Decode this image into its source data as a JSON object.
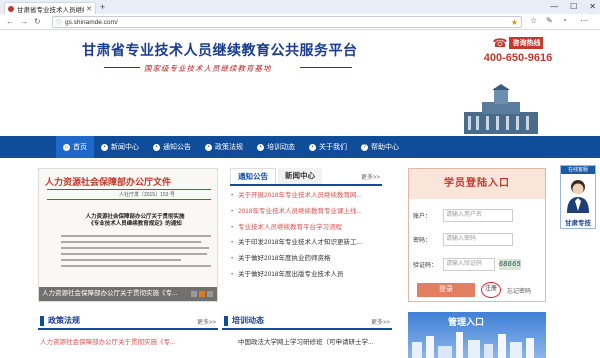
{
  "browser": {
    "tab_title": "甘肃省专业技术人员继续...",
    "url": "gs.shinamde.com/",
    "newtab": "+",
    "win_min": "—",
    "win_max": "☐",
    "win_close": "✕",
    "back": "←",
    "forward": "→",
    "refresh": "↻",
    "star": "★",
    "menu": "⋯"
  },
  "header": {
    "title": "甘肃省专业技术人员继续教育公共服务平台",
    "subtitle": "国家级专业技术人员继续教育基地",
    "hotline_label": "咨询热线",
    "hotline_number": "400-650-9616"
  },
  "nav": {
    "items": [
      {
        "label": "首页"
      },
      {
        "label": "新闻中心"
      },
      {
        "label": "通知公告"
      },
      {
        "label": "政策法规"
      },
      {
        "label": "培训动态"
      },
      {
        "label": "关于我们"
      },
      {
        "label": "帮助中心"
      }
    ]
  },
  "slide": {
    "doc_title": "人力资源社会保障部办公厅文件",
    "doc_number": "人社厅发〔2015〕153 号",
    "doc_heading": "人力资源社会保障部办公厅关于贯彻实施《专业技术人员继续教育规定》的通知",
    "caption": "人力资源社会保障部办公厅关于贯彻实施《专..."
  },
  "notice": {
    "tabs": [
      "通知公告",
      "新闻中心"
    ],
    "more": "更多>>",
    "items": [
      {
        "text": "关于开展2018年专业技术人员继续教育网...",
        "red": true
      },
      {
        "text": "2018年专业技术人员继续教育专业课上线...",
        "red": true
      },
      {
        "text": "专业技术人员继续教育平台学习流程",
        "red": true
      },
      {
        "text": "关于印发2018年专业技术人才知识更新工...",
        "red": false
      },
      {
        "text": "关于做好2018年度执业药师资格",
        "red": false
      },
      {
        "text": "关于做好2018年度出版专业技术人员",
        "red": false
      }
    ]
  },
  "login": {
    "title": "学员登陆入口",
    "account_label": "账户：",
    "account_placeholder": "请输入用户名",
    "password_label": "密码：",
    "password_placeholder": "请输入密码",
    "captcha_label": "验证码：",
    "captcha_placeholder": "请输入验证码",
    "captcha_code": "68665",
    "login_button": "登录",
    "register": "注册",
    "forgot": "忘记密码"
  },
  "service": {
    "top": "在线客服",
    "bottom": "甘肃专技"
  },
  "sections": {
    "policy": {
      "title": "政策法规",
      "more": "更多>>",
      "item": "人力资源社会保障部办公厅关于贯彻实施《专..."
    },
    "training": {
      "title": "培训动态",
      "more": "更多>>",
      "item": "中国政法大学网上学习研修班（可申请研士学..."
    },
    "mgmt": {
      "title": "管理入口"
    }
  }
}
